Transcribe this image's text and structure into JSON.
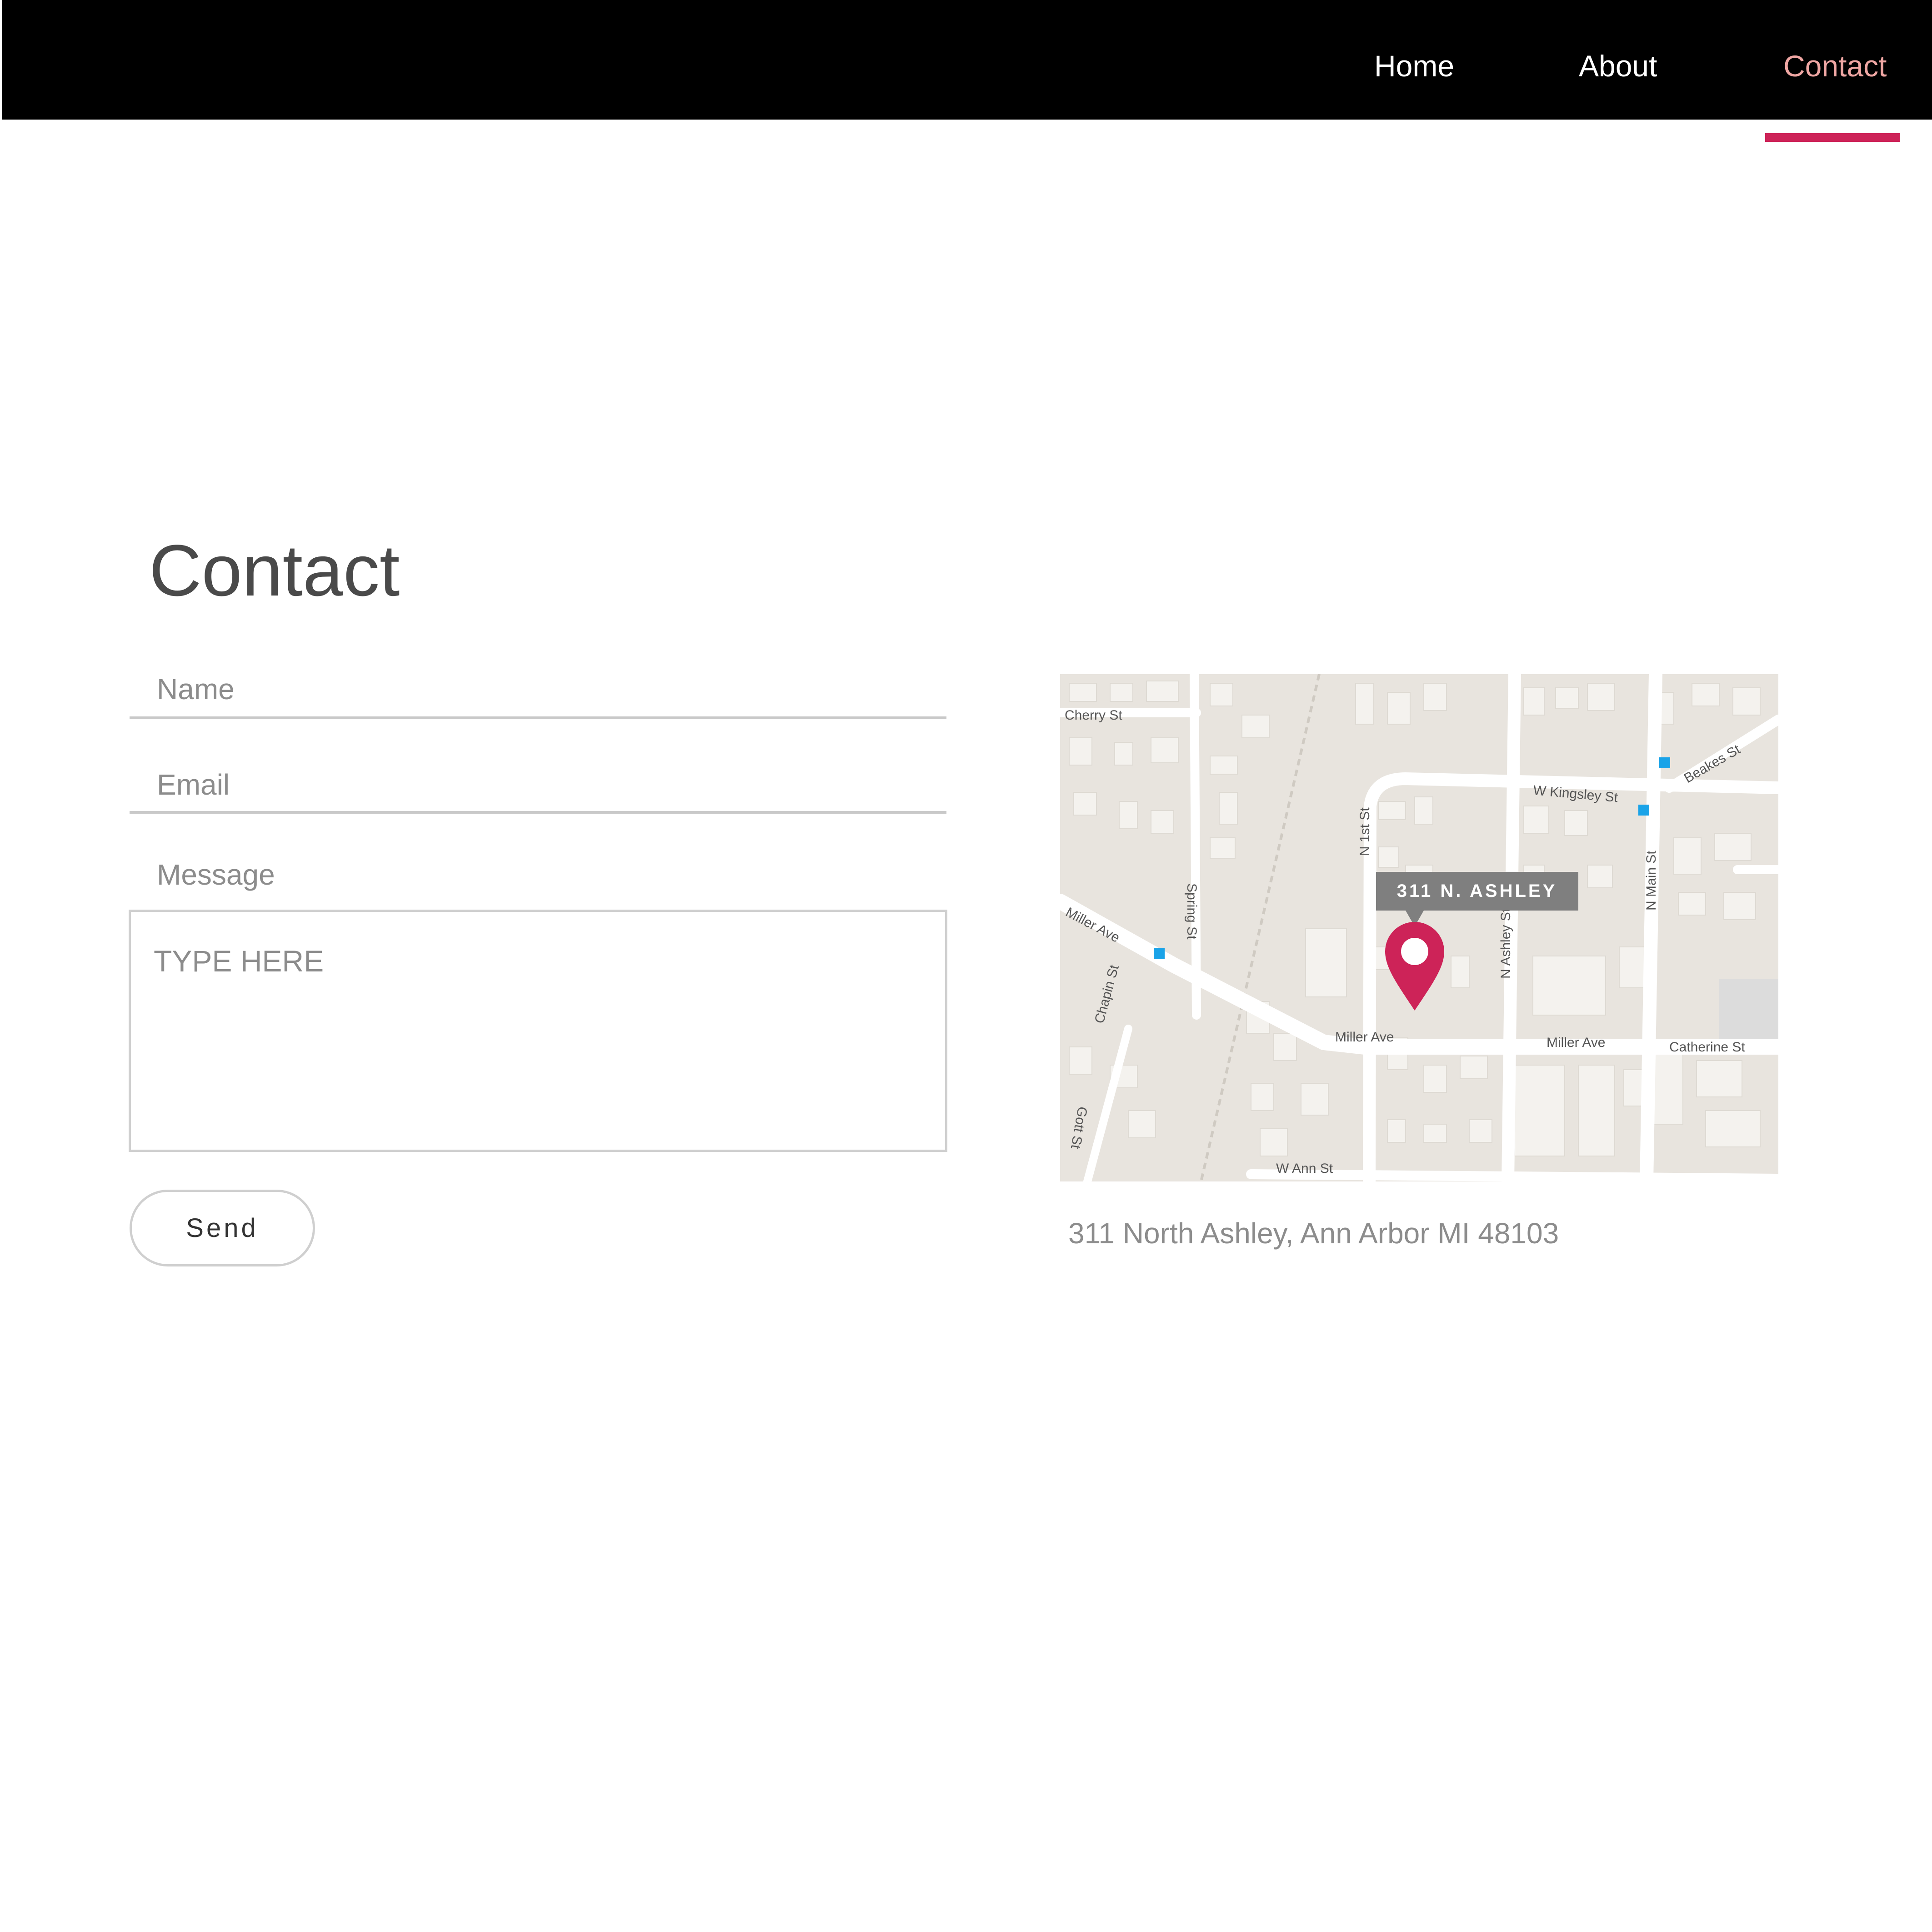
{
  "nav": {
    "items": [
      {
        "label": "Home",
        "active": false
      },
      {
        "label": "About",
        "active": false
      },
      {
        "label": "Contact",
        "active": true
      }
    ],
    "active_color": "#f0a7a4",
    "indicator_color": "#cd2358",
    "background": "#000000"
  },
  "page": {
    "title": "Contact"
  },
  "form": {
    "name_label": "Name",
    "email_label": "Email",
    "message_label": "Message",
    "name_value": "",
    "email_value": "",
    "message_placeholder": "TYPE HERE",
    "send_label": "Send"
  },
  "map": {
    "marker_label": "311 N. ASHLEY",
    "marker_color": "#cd2358",
    "streets": [
      "Cherry St",
      "W Kingsley St",
      "Beakes St",
      "N 1st St",
      "N Ashley St",
      "N Main St",
      "Miller Ave",
      "Miller Ave",
      "Miller Ave",
      "Catherine St",
      "Spring St",
      "Chapin St",
      "Gott St",
      "W Ann St"
    ]
  },
  "address": "311 North Ashley, Ann Arbor MI 48103"
}
